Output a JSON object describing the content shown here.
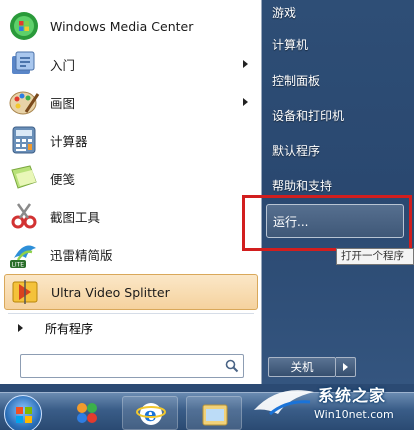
{
  "programs": [
    {
      "label": "Windows Media Center",
      "icon": "windows-media-center-icon",
      "has_submenu": false
    },
    {
      "label": "入门",
      "icon": "getting-started-icon",
      "has_submenu": true
    },
    {
      "label": "画图",
      "icon": "paint-icon",
      "has_submenu": true
    },
    {
      "label": "计算器",
      "icon": "calculator-icon",
      "has_submenu": false
    },
    {
      "label": "便笺",
      "icon": "sticky-notes-icon",
      "has_submenu": false
    },
    {
      "label": "截图工具",
      "icon": "snipping-tool-icon",
      "has_submenu": false
    },
    {
      "label": "迅雷精简版",
      "icon": "xunlei-lite-icon",
      "has_submenu": false
    },
    {
      "label": "Ultra Video Splitter",
      "icon": "ultra-video-splitter-icon",
      "has_submenu": false,
      "highlighted": true
    }
  ],
  "all_programs_label": "所有程序",
  "search": {
    "value": "",
    "placeholder": ""
  },
  "right_items": [
    "游戏",
    "计算机",
    "控制面板",
    "设备和打印机",
    "默认程序",
    "帮助和支持"
  ],
  "run_label": "运行...",
  "tooltip": "打开一个程序",
  "shutdown_label": "关机",
  "watermark": {
    "title": "系统之家",
    "url": "Win10net.com"
  },
  "colors": {
    "highlight": "#f5d29e",
    "red_frame": "#d21e1e",
    "right_pane": "#2e4e76"
  }
}
